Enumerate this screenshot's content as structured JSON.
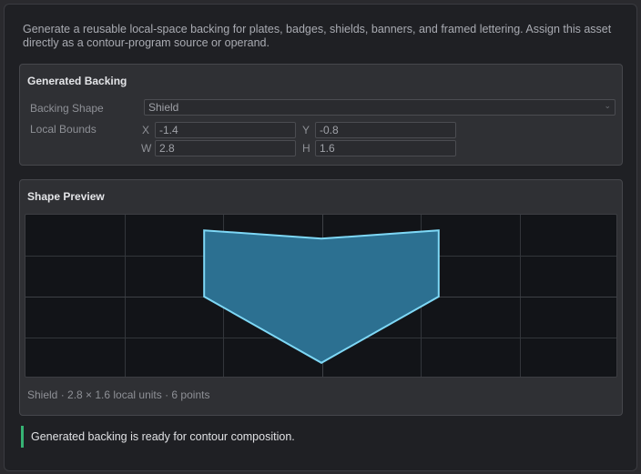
{
  "description": "Generate a reusable local-space backing for plates, badges, shields, banners, and framed lettering. Assign this asset directly as a contour-program source or operand.",
  "backing": {
    "title": "Generated Backing",
    "shape_label": "Backing Shape",
    "shape_value": "Shield",
    "bounds_label": "Local Bounds",
    "x_label": "X",
    "x_value": "-1.4",
    "y_label": "Y",
    "y_value": "-0.8",
    "w_label": "W",
    "w_value": "2.8",
    "h_label": "H",
    "h_value": "1.6"
  },
  "preview": {
    "title": "Shape Preview",
    "caption": "Shield · 2.8 × 1.6 local units · 6 points",
    "shape_points": [
      [
        -1.4,
        -0.8
      ],
      [
        0,
        -0.7
      ],
      [
        1.4,
        -0.8
      ],
      [
        1.4,
        -0.0
      ],
      [
        0,
        0.8
      ],
      [
        -1.4,
        0.0
      ]
    ],
    "fill_color": "#2c7091",
    "stroke_color": "#7ed8f6"
  },
  "status": {
    "message": "Generated backing is ready for contour composition.",
    "color": "#36b374"
  }
}
